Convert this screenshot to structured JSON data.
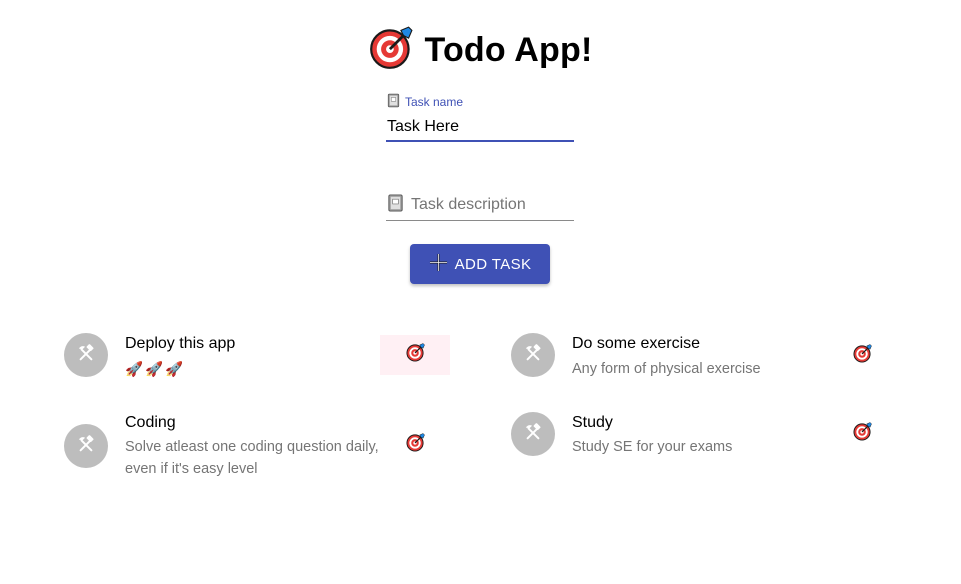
{
  "app": {
    "title": "Todo App!"
  },
  "form": {
    "name_label": "Task name",
    "name_value": "Task Here",
    "description_placeholder": "Task description",
    "add_button_label": "ADD TASK"
  },
  "tasks": [
    {
      "title": "Deploy this app",
      "description": "🚀🚀🚀"
    },
    {
      "title": "Do some exercise",
      "description": "Any form of physical exercise"
    },
    {
      "title": "Coding",
      "description_line1": "Solve atleast one coding question daily,",
      "description_line2": "even if it's easy level"
    },
    {
      "title": "Study",
      "description": "Study SE for your exams"
    }
  ],
  "icons": {
    "title": "target-icon",
    "label": "book-icon",
    "button": "plus-icon",
    "avatar": "hammer-pick-icon",
    "action": "target-icon"
  },
  "colors": {
    "primary": "#3f51b5",
    "avatar_bg": "#bdbdbd",
    "secondary_text": "#757575",
    "target_red": "#e53935",
    "dart_blue": "#1e88e5"
  }
}
